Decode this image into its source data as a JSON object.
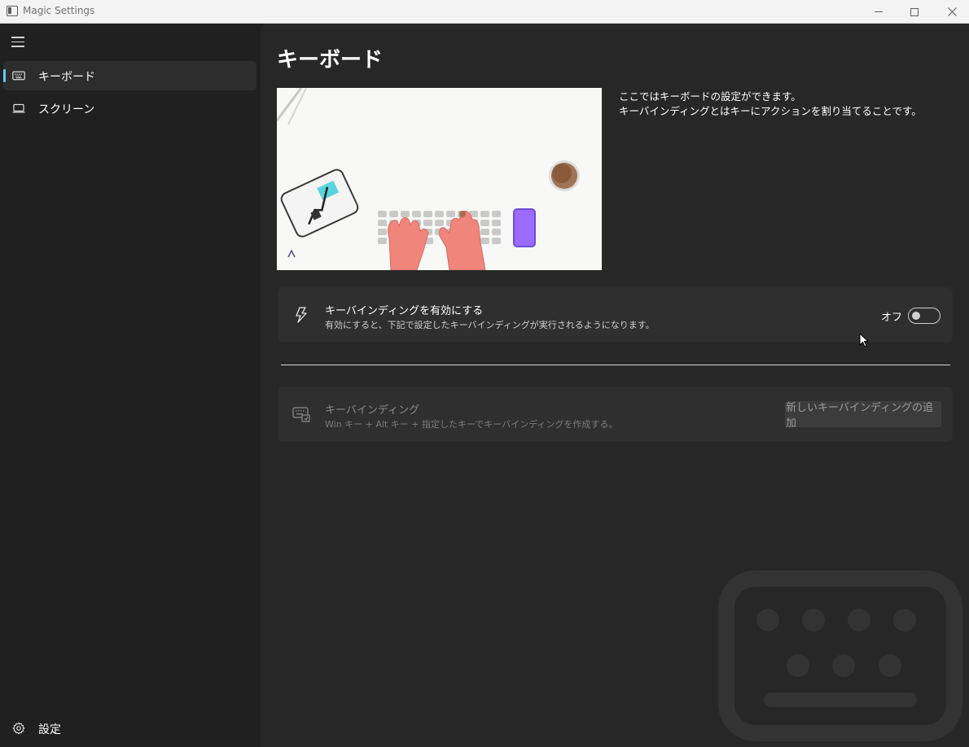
{
  "window": {
    "title": "Magic Settings"
  },
  "sidebar": {
    "items": [
      {
        "label": "キーボード",
        "icon": "keyboard-icon",
        "active": true
      },
      {
        "label": "スクリーン",
        "icon": "laptop-icon",
        "active": false
      }
    ],
    "footer": {
      "label": "設定",
      "icon": "gear-icon"
    }
  },
  "main": {
    "title": "キーボード",
    "description_line1": "ここではキーボードの設定ができます。",
    "description_line2": "キーバインディングとはキーにアクションを割り当てることです。",
    "enable_card": {
      "title": "キーバインディングを有効にする",
      "subtitle": "有効にすると、下記で設定したキーバインディングが実行されるようになります。",
      "toggle_label": "オフ",
      "toggle_on": false,
      "icon": "lightning-icon"
    },
    "bindings_card": {
      "title": "キーバインディング",
      "subtitle": "Win キー + Alt キー + 指定したキーでキーバインディングを作成する。",
      "button_label": "新しいキーバインディングの追加",
      "icon": "keyboard-shortcut-icon"
    }
  },
  "colors": {
    "accent": "#60cdff",
    "background": "#202020",
    "content": "#272727",
    "card": "#2f2f2f"
  }
}
